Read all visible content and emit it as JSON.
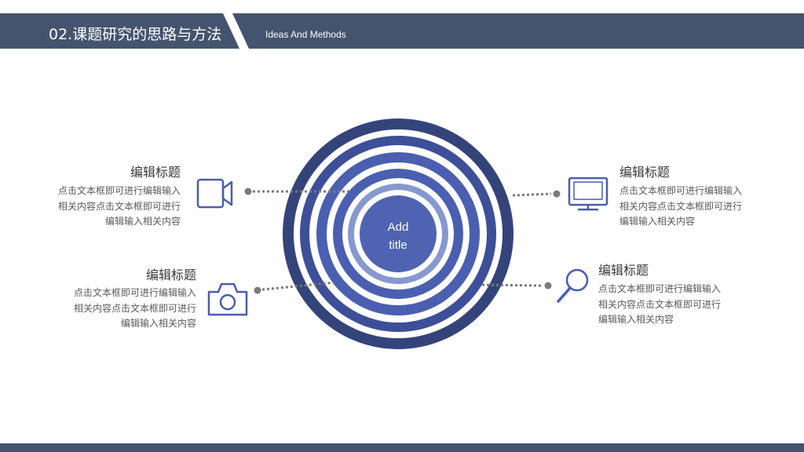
{
  "header": {
    "title": "02.课题研究的思路与方法",
    "subtitle": "Ideas And Methods"
  },
  "center": {
    "line1": "Add",
    "line2": "title"
  },
  "colors": {
    "header_bg": "#45546e",
    "ring_dark": "#34447a",
    "ring_mid": "#3d4f98",
    "ring_inner": "#4a5fb0",
    "ring_light": "#8798cf",
    "center_fill": "#5063b3",
    "icon": "#4a5db0",
    "dots": "#7a7a7a"
  },
  "items": [
    {
      "title": "编辑标题",
      "body": "点击文本框即可进行编辑输入相关内容点击文本框即可进行编辑输入相关内容",
      "icon": "video-camera-icon"
    },
    {
      "title": "编辑标题",
      "body": "点击文本框即可进行编辑输入相关内容点击文本框即可进行编辑输入相关内容",
      "icon": "camera-icon"
    },
    {
      "title": "编辑标题",
      "body": "点击文本框即可进行编辑输入相关内容点击文本框即可进行编辑输入相关内容",
      "icon": "monitor-icon"
    },
    {
      "title": "编辑标题",
      "body": "点击文本框即可进行编辑输入相关内容点击文本框即可进行编辑输入相关内容",
      "icon": "magnifier-icon"
    }
  ]
}
